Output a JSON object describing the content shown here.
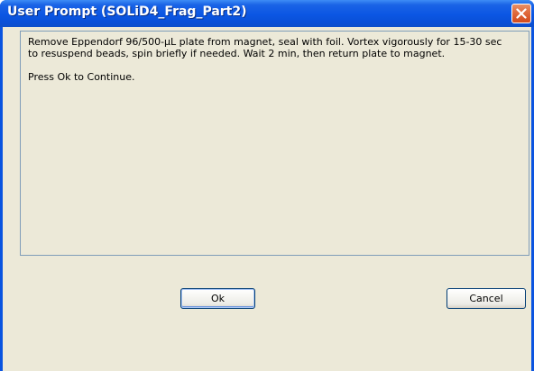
{
  "window": {
    "title": "User Prompt (SOLiD4_Frag_Part2)"
  },
  "message": {
    "body": "Remove Eppendorf 96/500-µL plate from magnet, seal with foil. Vortex vigorously for 15-30 sec to resuspend beads, spin briefly if needed. Wait 2 min, then return plate to magnet.",
    "prompt": "Press Ok to Continue."
  },
  "buttons": {
    "ok_label": "Ok",
    "cancel_label": "Cancel"
  },
  "icons": {
    "close": "close-icon"
  },
  "colors": {
    "titlebar": "#0a54e0",
    "client_background": "#ece9d8",
    "close_button": "#e06a3c",
    "panel_border": "#7f9db9",
    "button_border": "#003c74"
  }
}
